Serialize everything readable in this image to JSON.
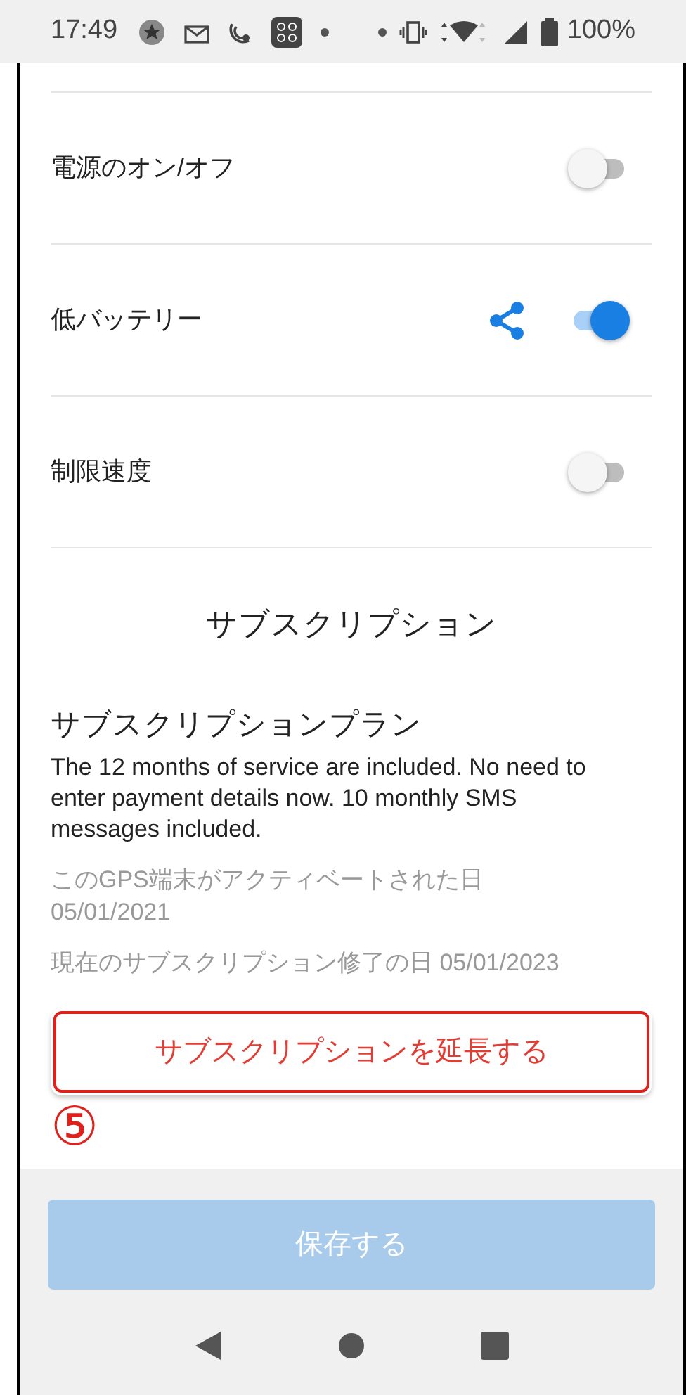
{
  "status_bar": {
    "time": "17:49",
    "battery": "100%"
  },
  "settings": [
    {
      "label": "電源のオン/オフ",
      "on": false,
      "share": false
    },
    {
      "label": "低バッテリー",
      "on": true,
      "share": true
    },
    {
      "label": "制限速度",
      "on": false,
      "share": false
    }
  ],
  "subscription": {
    "heading": "サブスクリプション",
    "plan_title": "サブスクリプションプラン",
    "description": "The 12 months of service are included. No need to enter payment details now. 10 monthly SMS messages included.",
    "activated": "このGPS端末がアクティベートされた日 05/01/2021",
    "end": "現在のサブスクリプション修了の日 05/01/2023",
    "extend_button": "サブスクリプションを延長する",
    "annotation": "⑤"
  },
  "save_button": {
    "label": "保存する",
    "disabled": true
  }
}
